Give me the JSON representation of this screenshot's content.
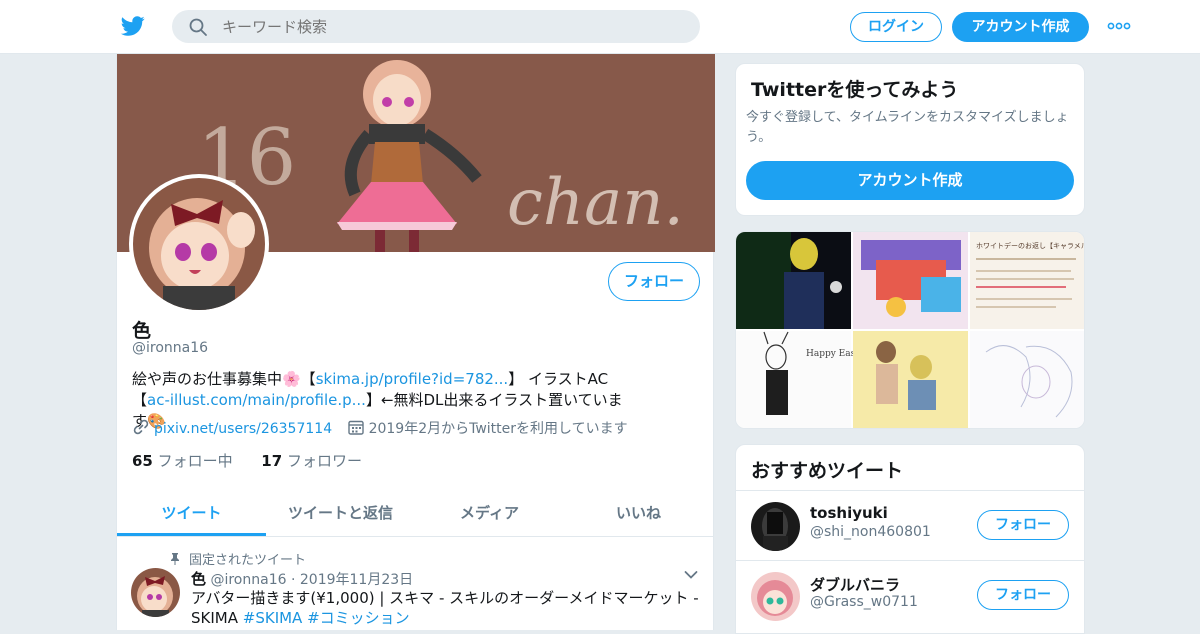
{
  "header": {
    "logo_icon": "twitter-bird-icon",
    "search_placeholder": "キーワード検索",
    "login_label": "ログイン",
    "signup_label": "アカウント作成",
    "accent_color": "#1da1f2"
  },
  "profile": {
    "banner_text": "16 chan.",
    "name": "色",
    "handle": "@ironna16",
    "follow_label": "フォロー",
    "bio": {
      "part1": "絵や声のお仕事募集中🌸【",
      "link1": "skima.jp/profile?id=782...",
      "part2": "】 イラストAC【",
      "link2": "ac-illust.com/main/profile.p...",
      "part3": "】←無料DL出来るイラスト置いています🎨"
    },
    "website": "pixiv.net/users/26357114",
    "joined": "2019年2月からTwitterを利用しています",
    "following_count": "65",
    "following_label": "フォロー中",
    "followers_count": "17",
    "followers_label": "フォロワー"
  },
  "tabs": [
    {
      "label": "ツイート"
    },
    {
      "label": "ツイートと返信"
    },
    {
      "label": "メディア"
    },
    {
      "label": "いいね"
    }
  ],
  "pinned_tweet": {
    "pinned_label": "固定されたツイート",
    "author": "色",
    "handle": "@ironna16",
    "date": "2019年11月23日",
    "text": "アバター描きます(¥1,000) | スキマ - スキルのオーダーメイドマーケット - SKIMA ",
    "hashtag1": "#SKIMA",
    "hashtag2": "#コミッション"
  },
  "signup_card": {
    "title": "Twitterを使ってみよう",
    "description": "今すぐ登録して、タイムラインをカスタマイズしましょう。",
    "button_label": "アカウント作成"
  },
  "media_card": {
    "tile_texts": [
      "Happy Easter?",
      "ホワイトデーのお返し【キャラメル】の意味！"
    ]
  },
  "recommendations": {
    "title": "おすすめツイート",
    "users": [
      {
        "name": "toshiyuki",
        "handle": "@shi_non460801",
        "follow_label": "フォロー"
      },
      {
        "name": "ダブルバニラ",
        "handle": "@Grass_w0711",
        "follow_label": "フォロー"
      }
    ]
  }
}
